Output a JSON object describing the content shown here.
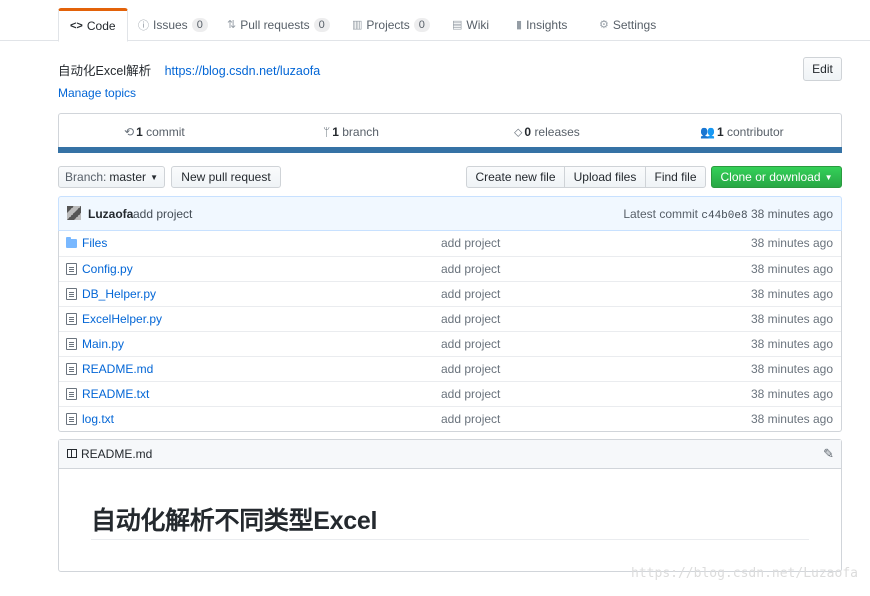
{
  "tabs": [
    {
      "icon": "code-icon",
      "glyph": "<>",
      "label": "Code",
      "count": null
    },
    {
      "icon": "issue-icon",
      "glyph": "ⓘ",
      "label": "Issues",
      "count": "0"
    },
    {
      "icon": "pull-request-icon",
      "glyph": "⇅",
      "label": "Pull requests",
      "count": "0"
    },
    {
      "icon": "project-icon",
      "glyph": "▥",
      "label": "Projects",
      "count": "0"
    },
    {
      "icon": "wiki-icon",
      "glyph": "▤",
      "label": "Wiki",
      "count": null
    },
    {
      "icon": "graph-icon",
      "glyph": "▮",
      "label": "Insights",
      "count": null
    },
    {
      "icon": "gear-icon",
      "glyph": "⚙",
      "label": "Settings",
      "count": null
    }
  ],
  "repo": {
    "description": "自动化Excel解析",
    "homepage": "https://blog.csdn.net/luzaofa",
    "manage_topics": "Manage topics",
    "edit_label": "Edit"
  },
  "summary": {
    "commits_count": "1",
    "commits_label": "commit",
    "branches_count": "1",
    "branches_label": "branch",
    "releases_count": "0",
    "releases_label": "releases",
    "contributors_count": "1",
    "contributors_label": "contributor",
    "language_color": "#3572a5"
  },
  "toolbar": {
    "branch_label": "Branch:",
    "branch_name": "master",
    "new_pull_request": "New pull request",
    "create_new_file": "Create new file",
    "upload_files": "Upload files",
    "find_file": "Find file",
    "clone_or_download": "Clone or download"
  },
  "commit": {
    "author": "Luzaofa",
    "message": "add project",
    "latest_label": "Latest commit",
    "sha": "c44b0e8",
    "age": "38 minutes ago"
  },
  "files": [
    {
      "type": "dir",
      "name": "Files",
      "message": "add project",
      "age": "38 minutes ago"
    },
    {
      "type": "file",
      "name": "Config.py",
      "message": "add project",
      "age": "38 minutes ago"
    },
    {
      "type": "file",
      "name": "DB_Helper.py",
      "message": "add project",
      "age": "38 minutes ago"
    },
    {
      "type": "file",
      "name": "ExcelHelper.py",
      "message": "add project",
      "age": "38 minutes ago"
    },
    {
      "type": "file",
      "name": "Main.py",
      "message": "add project",
      "age": "38 minutes ago"
    },
    {
      "type": "file",
      "name": "README.md",
      "message": "add project",
      "age": "38 minutes ago"
    },
    {
      "type": "file",
      "name": "README.txt",
      "message": "add project",
      "age": "38 minutes ago"
    },
    {
      "type": "file",
      "name": "log.txt",
      "message": "add project",
      "age": "38 minutes ago"
    }
  ],
  "readme": {
    "filename": "README.md",
    "heading": "自动化解析不同类型Excel"
  },
  "watermark": "https://blog.csdn.net/Luzaofa"
}
